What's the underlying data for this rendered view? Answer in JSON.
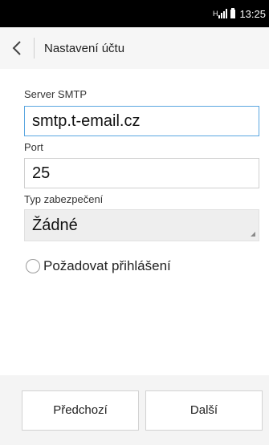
{
  "status_bar": {
    "time": "13:25",
    "network_label": "H"
  },
  "header": {
    "title": "Nastavení účtu"
  },
  "form": {
    "server": {
      "label": "Server SMTP",
      "value": "smtp.t-email.cz"
    },
    "port": {
      "label": "Port",
      "value": "25"
    },
    "security": {
      "label": "Typ zabezpečení",
      "value": "Žádné"
    },
    "require_login": {
      "label": "Požadovat přihlášení",
      "checked": false
    }
  },
  "buttons": {
    "previous": "Předchozí",
    "next": "Další"
  },
  "colors": {
    "focus_border": "#5aa6e0",
    "status_bar_bg": "#000000"
  }
}
